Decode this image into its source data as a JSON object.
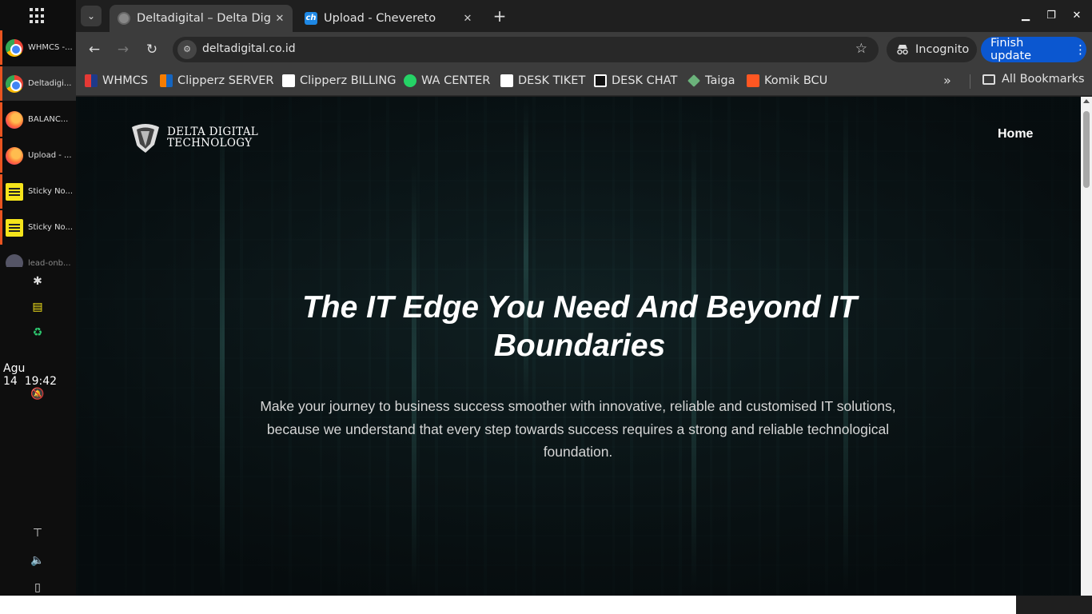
{
  "dock": {
    "items": [
      {
        "label": "WHMCS -...",
        "icon": "chrome-icon"
      },
      {
        "label": "Deltadigi...",
        "icon": "chrome-icon"
      },
      {
        "label": "BALANC...",
        "icon": "firefox-icon"
      },
      {
        "label": "Upload - ...",
        "icon": "firefox-icon"
      },
      {
        "label": "Sticky No...",
        "icon": "sticky-notes-icon"
      },
      {
        "label": "Sticky No...",
        "icon": "sticky-notes-icon"
      },
      {
        "label": "lead-onb...",
        "icon": "app-icon"
      }
    ],
    "date": "Agu 14",
    "time": "19:42"
  },
  "browser": {
    "tabs": [
      {
        "title": "Deltadigital – Delta Digit",
        "active": true
      },
      {
        "title": "Upload - Chevereto",
        "active": false
      }
    ],
    "url": "deltadigital.co.id",
    "incognito_label": "Incognito",
    "finish_update_label": "Finish update",
    "bookmarks": [
      "WHMCS",
      "Clipperz SERVER",
      "Clipperz BILLING",
      "WA CENTER",
      "DESK TIKET",
      "DESK CHAT",
      "Taiga",
      "Komik BCU"
    ],
    "all_bookmarks_label": "All Bookmarks"
  },
  "page": {
    "logo_line1": "DELTA DIGITAL",
    "logo_line2": "TECHNOLOGY",
    "nav_home": "Home",
    "hero_title": "The IT Edge You Need And Beyond IT Boundaries",
    "hero_subtitle": "Make your journey to business success smoother with innovative, reliable and customised IT solutions, because we understand that every step towards success requires a strong and reliable technological foundation."
  },
  "colors": {
    "accent_update": "#0b57d0",
    "dock_running_indicator": "#e95420"
  }
}
